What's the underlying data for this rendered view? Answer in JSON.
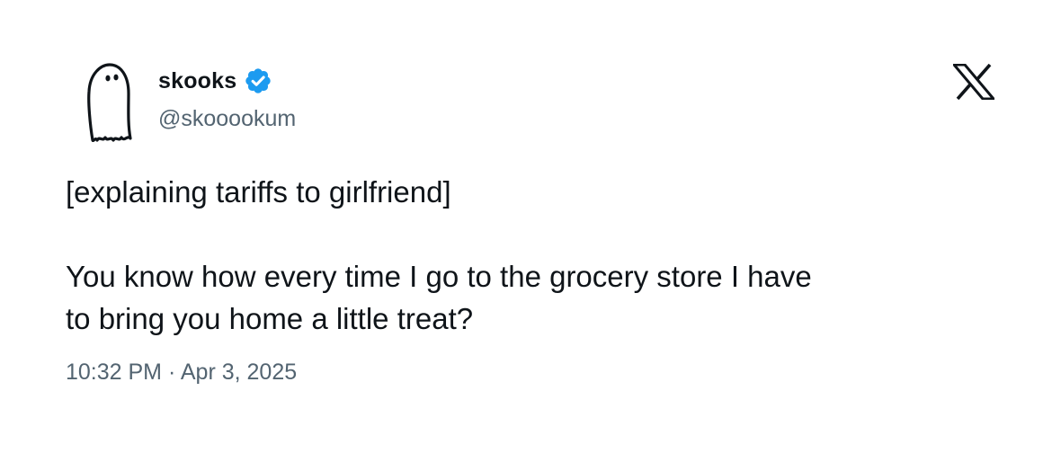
{
  "tweet": {
    "author": {
      "display_name": "skooks",
      "handle": "@skooookum",
      "verified": true,
      "avatar_icon": "ghost-icon",
      "verified_color": "#1d9bf0"
    },
    "platform_icon": "x-logo-icon",
    "body": {
      "line1": "[explaining tariffs to girlfriend]",
      "line2": "You know how every time I go to the grocery store I have",
      "line3": "to bring you home a little treat?"
    },
    "timestamp": {
      "time": "10:32 PM",
      "separator": "·",
      "date": "Apr 3, 2025"
    }
  },
  "colors": {
    "text_primary": "#0f1419",
    "text_secondary": "#536471",
    "background": "#ffffff"
  }
}
